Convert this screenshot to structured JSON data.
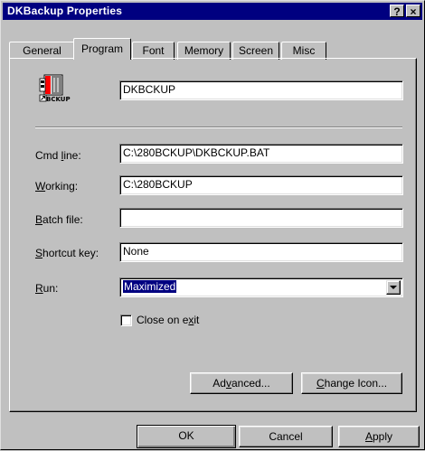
{
  "window": {
    "title": "DKBackup Properties",
    "help_button": "?",
    "close_button": "×"
  },
  "tabs": [
    {
      "label": "General",
      "active": false
    },
    {
      "label": "Program",
      "active": true
    },
    {
      "label": "Font",
      "active": false
    },
    {
      "label": "Memory",
      "active": false
    },
    {
      "label": "Screen",
      "active": false
    },
    {
      "label": "Misc",
      "active": false
    }
  ],
  "program": {
    "icon_caption": "BCKUP",
    "name_value": "DKBCKUP",
    "cmd_line": {
      "label_pre": "Cmd ",
      "label_acc": "l",
      "label_post": "ine:",
      "value": "C:\\280BCKUP\\DKBCKUP.BAT"
    },
    "working": {
      "label_pre": "",
      "label_acc": "W",
      "label_post": "orking:",
      "value": "C:\\280BCKUP"
    },
    "batch_file": {
      "label_pre": "",
      "label_acc": "B",
      "label_post": "atch file:",
      "value": ""
    },
    "shortcut_key": {
      "label_pre": "",
      "label_acc": "S",
      "label_post": "hortcut key:",
      "value": "None"
    },
    "run": {
      "label_pre": "",
      "label_acc": "R",
      "label_post": "un:",
      "value": "Maximized"
    },
    "close_on_exit": {
      "label_pre": "Close on e",
      "label_acc": "x",
      "label_post": "it",
      "checked": false
    },
    "advanced": {
      "label_pre": "Ad",
      "label_acc": "v",
      "label_post": "anced..."
    },
    "change_icon": {
      "label_pre": "",
      "label_acc": "C",
      "label_post": "hange Icon..."
    }
  },
  "footer": {
    "ok": "OK",
    "cancel": "Cancel",
    "apply_acc": "A",
    "apply_post": "pply"
  }
}
